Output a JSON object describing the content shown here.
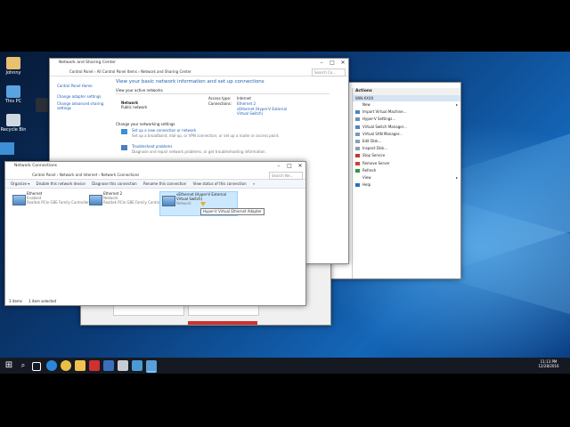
{
  "desktop": {
    "icons": [
      {
        "label": "Johnny"
      },
      {
        "label": "This PC"
      },
      {
        "label": "Recycle Bin"
      }
    ]
  },
  "network_sharing_center": {
    "title": "Network and Sharing Center",
    "breadcrumb": [
      "Control Panel",
      "All Control Panel Items",
      "Network and Sharing Center"
    ],
    "search_placeholder": "Search Co...",
    "sidebar": {
      "home": "Control Panel Home",
      "change_adapter": "Change adapter settings",
      "change_advanced": "Change advanced sharing settings"
    },
    "heading": "View your basic network information and set up connections",
    "active_networks_label": "View your active networks",
    "network_name": "Network",
    "network_type": "Public network",
    "access_type_label": "Access type:",
    "access_type_value": "Internet",
    "connections_label": "Connections:",
    "connection_1": "Ethernet 2",
    "connection_2": "vEthernet (Hyper-V External Virtual Switch)",
    "change_settings_label": "Change your networking settings",
    "setup_link": "Set up a new connection or network",
    "setup_desc": "Set up a broadband, dial-up, or VPN connection; or set up a router or access point.",
    "troubleshoot_link": "Troubleshoot problems",
    "troubleshoot_desc": "Diagnose and repair network problems, or get troubleshooting information."
  },
  "network_connections": {
    "title": "Network Connections",
    "breadcrumb": [
      "Control Panel",
      "Network and Internet",
      "Network Connections"
    ],
    "search_placeholder": "Search Ne...",
    "toolbar": [
      "Organize ▾",
      "Disable this network device",
      "Diagnose this connection",
      "Rename this connection",
      "View status of this connection",
      "»"
    ],
    "adapters": [
      {
        "name": "Ethernet",
        "status": "Enabled",
        "device": "Realtek PCIe GBE Family Controller"
      },
      {
        "name": "Ethernet 2",
        "status": "Network",
        "device": "Realtek PCIe GBE Family Controller"
      },
      {
        "name": "vEthernet (Hyper-V External Virtual Switch)",
        "status": "Network",
        "device": ""
      }
    ],
    "tooltip": "Hyper-V Virtual Ethernet Adapter",
    "status_items": "3 items",
    "status_selected": "1 item selected"
  },
  "hyperv_actions": {
    "header": "Actions",
    "section": "WIN-XXXX",
    "items": [
      {
        "label": "New",
        "arrow": "▸",
        "icon_color": "#ffffff"
      },
      {
        "label": "Import Virtual Machine...",
        "arrow": "",
        "icon_color": "#4a86c4"
      },
      {
        "label": "Hyper-V Settings...",
        "arrow": "",
        "icon_color": "#6a8fb5"
      },
      {
        "label": "Virtual Switch Manager...",
        "arrow": "",
        "icon_color": "#4a86c4"
      },
      {
        "label": "Virtual SAN Manager...",
        "arrow": "",
        "icon_color": "#7a9ab8"
      },
      {
        "label": "Edit Disk...",
        "arrow": "",
        "icon_color": "#8aa0b5"
      },
      {
        "label": "Inspect Disk...",
        "arrow": "",
        "icon_color": "#8aa0b5"
      },
      {
        "label": "Stop Service",
        "arrow": "",
        "icon_color": "#c0392b"
      },
      {
        "label": "Remove Server",
        "arrow": "",
        "icon_color": "#d04030"
      },
      {
        "label": "Refresh",
        "arrow": "",
        "icon_color": "#2e9b3f"
      },
      {
        "label": "View",
        "arrow": "▸",
        "icon_color": "#ffffff"
      },
      {
        "label": "Help",
        "arrow": "",
        "icon_color": "#2b6fc2"
      }
    ]
  },
  "taskbar": {
    "time": "11:13 PM",
    "date": "12/28/2016"
  },
  "colors": {
    "accent": "#1a5fb4",
    "selection": "#cce8ff",
    "taskbar": "#151a22"
  }
}
